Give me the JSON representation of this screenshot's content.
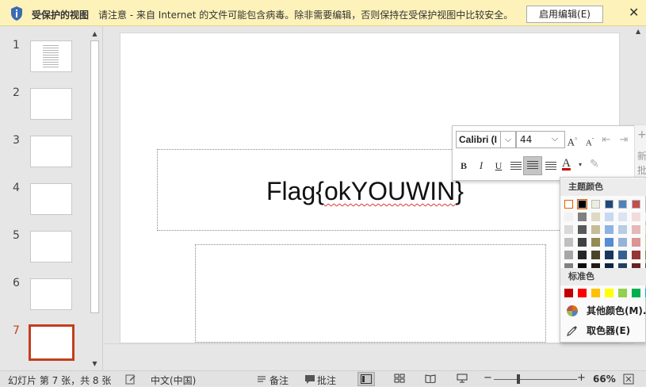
{
  "protected_view": {
    "title": "受保护的视图",
    "message": "请注意 - 来自 Internet 的文件可能包含病毒。除非需要编辑，否则保持在受保护视图中比较安全。",
    "enable_button": "启用编辑(E)",
    "close_glyph": "✕"
  },
  "thumbnails": [
    {
      "num": "1",
      "has_content": true
    },
    {
      "num": "2"
    },
    {
      "num": "3"
    },
    {
      "num": "4"
    },
    {
      "num": "5"
    },
    {
      "num": "6"
    },
    {
      "num": "7",
      "active": true
    }
  ],
  "slide": {
    "title_prefix": "Flag{",
    "title_misspelled": "okYOUWIN",
    "title_suffix": "}"
  },
  "mini_toolbar": {
    "font_name": "Calibri (I",
    "font_size": "44",
    "grow_font": "A",
    "shrink_font": "A",
    "bold": "B",
    "italic": "I",
    "underline": "U",
    "font_color_letter": "A",
    "new_label_1": "新",
    "new_label_2": "批"
  },
  "color_panel": {
    "theme_header": "主题颜色",
    "standard_header": "标准色",
    "more_colors": "其他颜色(M)...",
    "eyedropper": "取色器(E)",
    "theme_top_row": [
      "#ffffff",
      "#000000",
      "#eeece1",
      "#1f497d",
      "#4f81bd",
      "#c0504d",
      "#9bbb59"
    ],
    "theme_columns": [
      [
        "#f2f2f2",
        "#d9d9d9",
        "#bfbfbf",
        "#a6a6a6",
        "#808080"
      ],
      [
        "#808080",
        "#595959",
        "#404040",
        "#262626",
        "#0d0d0d"
      ],
      [
        "#ddd9c3",
        "#c4bd97",
        "#948a54",
        "#4a452a",
        "#1e1c11"
      ],
      [
        "#c6d9f0",
        "#8db3e2",
        "#548dd4",
        "#17365d",
        "#0f243e"
      ],
      [
        "#dbe5f1",
        "#b8cce4",
        "#95b3d7",
        "#366092",
        "#244061"
      ],
      [
        "#f2dcdb",
        "#e5b9b7",
        "#d99694",
        "#953734",
        "#632423"
      ],
      [
        "#ebf1dd",
        "#d7e3bc",
        "#c3d69b",
        "#76923c",
        "#4f6128"
      ]
    ],
    "standard_colors": [
      "#c00000",
      "#ff0000",
      "#ffc000",
      "#ffff00",
      "#92d050",
      "#00b050",
      "#00b0f0"
    ]
  },
  "status_bar": {
    "slide_info": "幻灯片 第 7 张，共 8 张",
    "language": "中文(中国)",
    "notes": "备注",
    "comments": "批注",
    "zoom_minus": "−",
    "zoom_plus": "+",
    "zoom": "66%"
  }
}
